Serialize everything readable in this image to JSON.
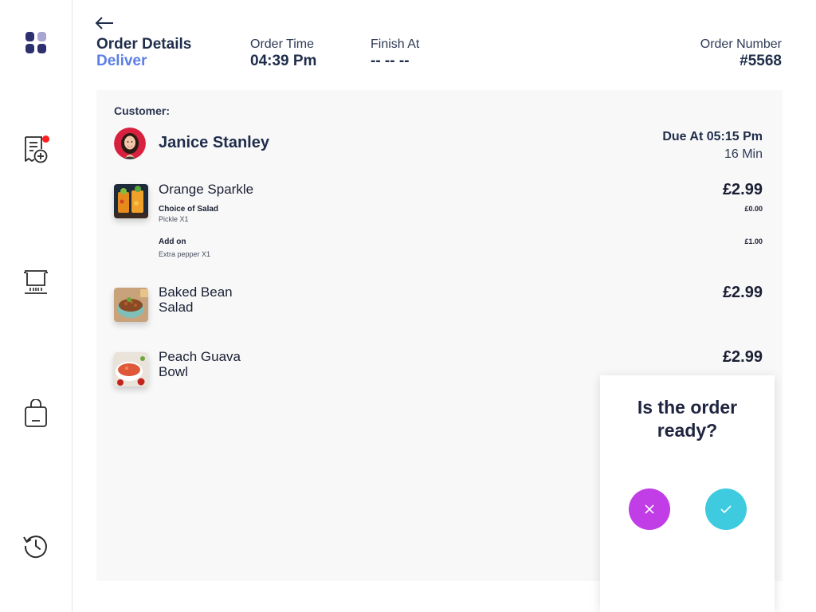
{
  "sidebar": {
    "items": [
      {
        "name": "dashboard",
        "icon": "grid-icon"
      },
      {
        "name": "new-orders",
        "icon": "receipt-add-icon",
        "has_notification": true
      },
      {
        "name": "kitchen",
        "icon": "cooking-pot-icon"
      },
      {
        "name": "shop",
        "icon": "shopping-bag-icon"
      },
      {
        "name": "history",
        "icon": "history-icon"
      }
    ],
    "notification_color": "#ff1f1f"
  },
  "header": {
    "title": "Order Details",
    "order_type": "Deliver",
    "order_time_label": "Order Time",
    "order_time": "04:39 Pm",
    "finish_label": "Finish At",
    "finish_value": "-- -- --",
    "order_number_label": "Order Number",
    "order_number": "#5568"
  },
  "customer": {
    "label": "Customer:",
    "name": "Janice Stanley",
    "due": "Due At 05:15 Pm",
    "due_in": "16 Min"
  },
  "items": [
    {
      "name": "Orange Sparkle",
      "price": "£2.99",
      "options": [
        {
          "title": "Choice of Salad",
          "detail": "Pickle  X1",
          "price": "£0.00"
        },
        {
          "title": "Add on",
          "detail": "Extra pepper  X1",
          "price": "£1.00"
        }
      ]
    },
    {
      "name_line1": "Baked Bean",
      "name_line2": "Salad",
      "price": "£2.99"
    },
    {
      "name_line1": "Peach Guava",
      "name_line2": "Bowl",
      "price": "£2.99"
    }
  ],
  "dialog": {
    "question_line1": "Is the order",
    "question_line2": "ready?",
    "no_icon": "close-icon",
    "yes_icon": "check-icon",
    "no_color": "#c13de6",
    "yes_color": "#3ecbe0"
  },
  "colors": {
    "accent": "#5b7ee8",
    "text_primary": "#1f2d4b"
  }
}
